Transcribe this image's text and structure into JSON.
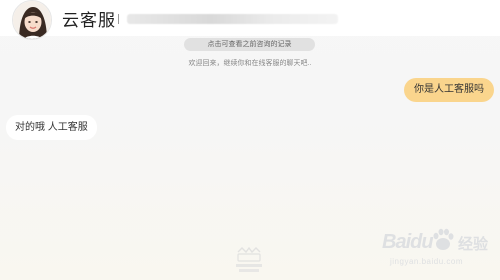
{
  "header": {
    "title": "云客服",
    "avatar_icon": "agent-avatar-icon"
  },
  "chat": {
    "history_link": "点击可查看之前咨询的记录",
    "welcome_text": "欢迎回来，继续你和在线客服的聊天吧..",
    "messages": [
      {
        "side": "right",
        "text": "你是人工客服吗"
      },
      {
        "side": "left",
        "text": "对的哦 人工客服"
      }
    ]
  },
  "watermarks": {
    "baidu_logo_text": "Baidu",
    "baidu_cn": "经验",
    "baidu_url": "jingyan.baidu.com"
  },
  "colors": {
    "user_bubble": "#fad58d",
    "agent_bubble": "#ffffff",
    "history_pill": "#e1e1e1"
  }
}
